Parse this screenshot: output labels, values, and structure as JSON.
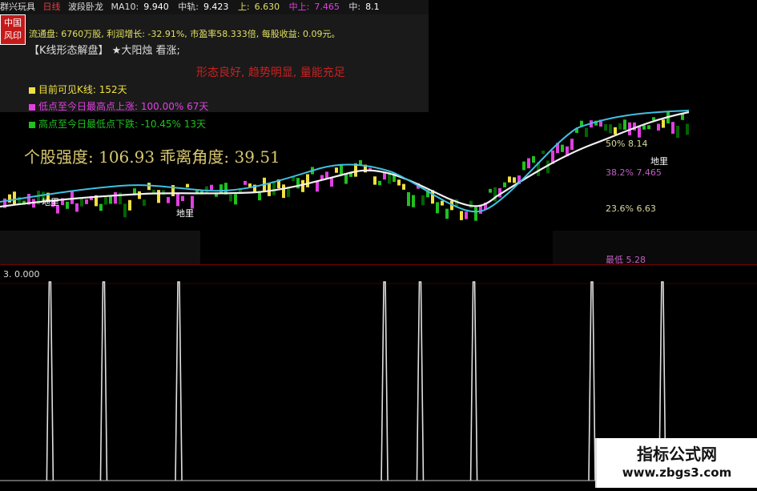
{
  "header": {
    "stock_name": "群兴玩具",
    "period": "日线",
    "indicator": "波段卧龙",
    "ma_label": "MA10:",
    "ma_value": "9.940",
    "mid_label": "中轨:",
    "mid_value": "9.423",
    "up_label": "上:",
    "up_value": "6.630",
    "mid_up_label": "中上:",
    "mid_up_value": "7.465",
    "mid2_label": "中:",
    "mid2_value": "8.1"
  },
  "logo": {
    "line1": "中国",
    "line2": "风印"
  },
  "info": {
    "line1": "流通盘: 6760万股, 利润增长: -32.91%, 市盈率58.333倍, 每股收益: 0.09元。",
    "pattern_label": "【K线形态解盘】",
    "pattern_value": "★大阳烛  看涨;",
    "red_text": "形态良好, 趋势明显, 量能充足"
  },
  "legend": [
    {
      "label": "目前可见K线: 152天",
      "color": "#f0e040",
      "text_color": "#f0e040"
    },
    {
      "label": "低点至今日最高点上涨: 100.00% 67天",
      "color": "#e040e0",
      "text_color": "#e040e0"
    },
    {
      "label": "高点至今日最低点下跌: -10.45% 13天",
      "color": "#20c020",
      "text_color": "#20c020"
    }
  ],
  "strength": "个股强度: 106.93  乖离角度: 39.51",
  "fib": [
    {
      "label": "50%",
      "value": "8.14",
      "color": "#d8d8a0"
    },
    {
      "label": "38.2%",
      "value": "7.465",
      "color": "#c060c0"
    },
    {
      "label": "23.6%",
      "value": "6.63",
      "color": "#d8d8a0"
    },
    {
      "label": "最低",
      "value": "5.28",
      "color": "#c060c0"
    }
  ],
  "chart_labels": {
    "dili": "地里",
    "dili2": "地里",
    "dili3": "地里"
  },
  "bottom": {
    "value_label": "3. 0.000",
    "chart_data": {
      "type": "line",
      "ylim": [
        0,
        3
      ],
      "spikes_x_fraction": [
        0.066,
        0.137,
        0.236,
        0.508,
        0.555,
        0.626,
        0.782,
        0.875
      ]
    }
  },
  "watermark": {
    "title": "指标公式网",
    "url": "www.zbgs3.com"
  }
}
